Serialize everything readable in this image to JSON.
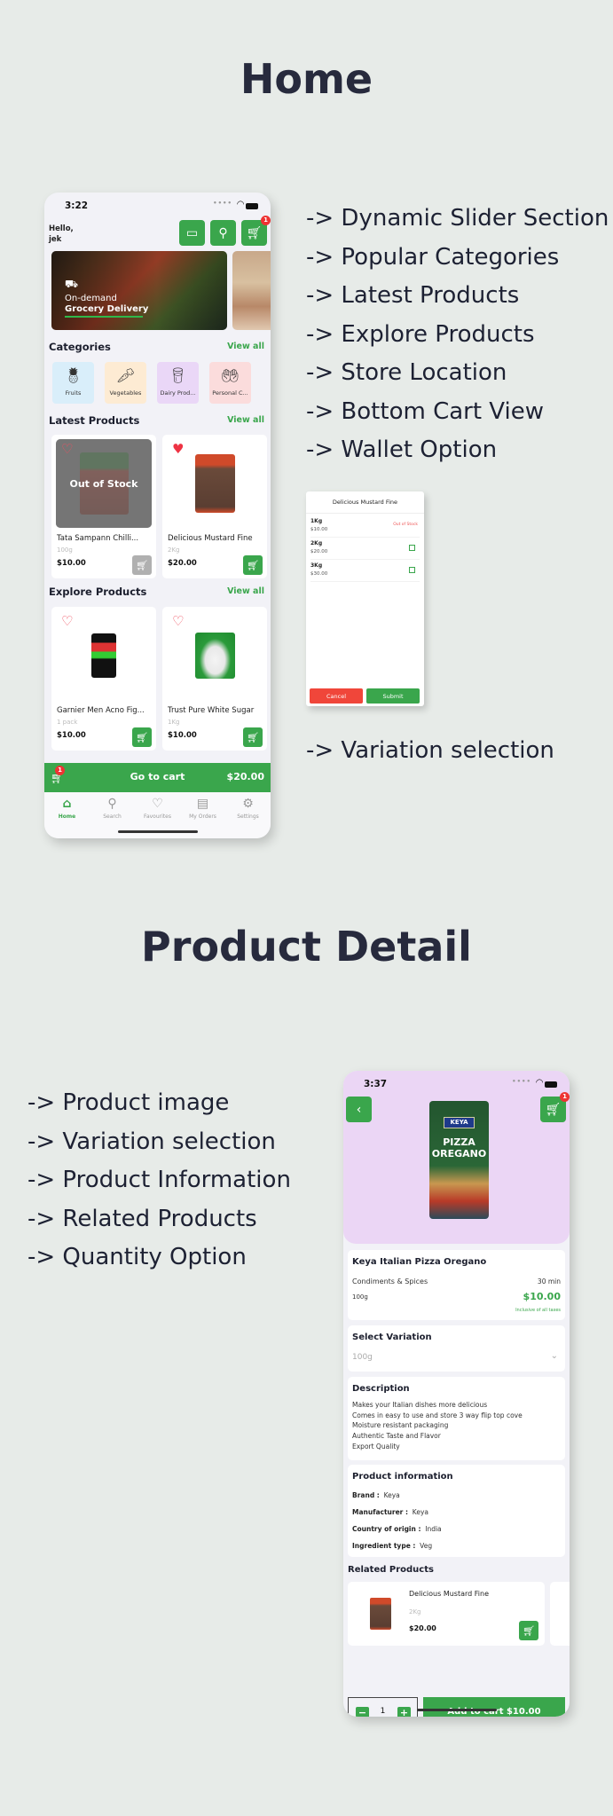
{
  "sections": {
    "home_title": "Home",
    "product_detail_title": "Product Detail"
  },
  "home_features": [
    "-> Dynamic Slider Section",
    "-> Popular Categories",
    "-> Latest Products",
    "-> Explore Products",
    "-> Store Location",
    "-> Bottom Cart View",
    "->  Wallet Option"
  ],
  "variation_feature": "-> Variation selection",
  "detail_features": [
    "-> Product image",
    "-> Variation selection",
    "-> Product Information",
    "-> Related Products",
    "-> Quantity Option"
  ],
  "colors": {
    "brand_green": "#3aa64c",
    "badge_red": "#ee3333",
    "background": "#e7ebe8",
    "heading": "#272a3d"
  },
  "home_screen": {
    "status_time": "3:22",
    "greeting_line1": "Hello,",
    "greeting_line2": "jek",
    "header_buttons": [
      {
        "icon": "wallet-icon"
      },
      {
        "icon": "store-location-icon"
      },
      {
        "icon": "cart-icon",
        "badge": "1"
      }
    ],
    "banner": {
      "line1": "On-demand",
      "line2": "Grocery Delivery"
    },
    "categories_title": "Categories",
    "categories_view_all": "View all",
    "categories": [
      {
        "label": "Fruits",
        "color": "#d9eefa",
        "icon": "fruits-icon"
      },
      {
        "label": "Vegetables",
        "color": "#fdebd3",
        "icon": "vegetables-icon"
      },
      {
        "label": "Dairy Prod...",
        "color": "#ead7f7",
        "icon": "dairy-icon"
      },
      {
        "label": "Personal C...",
        "color": "#fbdcdc",
        "icon": "personal-care-icon"
      }
    ],
    "latest_title": "Latest Products",
    "latest_view_all": "View all",
    "latest_products": [
      {
        "name": "Tata Sampann Chilli...",
        "weight": "100g",
        "price": "$10.00",
        "out_of_stock": true,
        "out_of_stock_label": "Out of Stock",
        "favourite": false
      },
      {
        "name": "Delicious Mustard Fine",
        "weight": "2Kg",
        "price": "$20.00",
        "out_of_stock": false,
        "favourite": true
      }
    ],
    "explore_title": "Explore Products",
    "explore_view_all": "View all",
    "explore_products": [
      {
        "name": "Garnier Men Acno Fig...",
        "weight": "1 pack",
        "price": "$10.00",
        "favourite": false
      },
      {
        "name": "Trust Pure White Sugar",
        "weight": "1Kg",
        "price": "$10.00",
        "favourite": false
      }
    ],
    "cart_bar": {
      "badge": "1",
      "label": "Go to cart",
      "total": "$20.00"
    },
    "tabs": [
      {
        "label": "Home",
        "icon": "home-icon",
        "active": true
      },
      {
        "label": "Search",
        "icon": "search-icon",
        "active": false
      },
      {
        "label": "Favourites",
        "icon": "heart-icon",
        "active": false
      },
      {
        "label": "My Orders",
        "icon": "orders-icon",
        "active": false
      },
      {
        "label": "Settings",
        "icon": "settings-icon",
        "active": false
      }
    ]
  },
  "variation_modal": {
    "title": "Delicious Mustard Fine",
    "options": [
      {
        "weight": "1Kg",
        "price": "$10.00",
        "status": "Out of Stock"
      },
      {
        "weight": "2Kg",
        "price": "$20.00",
        "checked": false
      },
      {
        "weight": "3Kg",
        "price": "$30.00",
        "checked": false
      }
    ],
    "cancel_label": "Cancel",
    "submit_label": "Submit"
  },
  "detail_screen": {
    "status_time": "3:37",
    "cart_badge": "1",
    "product_image_text": {
      "brand": "KEYA",
      "line1": "PIZZA",
      "line2": "OREGANO"
    },
    "name": "Keya Italian Pizza Oregano",
    "category": "Condiments & Spices",
    "delivery_time": "30 min",
    "weight": "100g",
    "price": "$10.00",
    "tax_note": "Inclusive of all taxes",
    "variation_title": "Select Variation",
    "variation_selected": "100g",
    "description_title": "Description",
    "description_lines": [
      "Makes your Italian dishes more delicious",
      "Comes in easy to use and store 3 way flip top cove",
      "Moisture resistant packaging",
      "Authentic Taste and Flavor",
      "Export Quality"
    ],
    "info_title": "Product information",
    "info": [
      {
        "label": "Brand :",
        "value": "Keya"
      },
      {
        "label": "Manufacturer :",
        "value": "Keya"
      },
      {
        "label": "Country of origin :",
        "value": "India"
      },
      {
        "label": "Ingredient type :",
        "value": "Veg"
      }
    ],
    "related_title": "Related Products",
    "related_products": [
      {
        "name": "Delicious Mustard Fine",
        "weight": "2Kg",
        "price": "$20.00"
      }
    ],
    "quantity": "1",
    "add_to_cart_label": "Add to cart $10.00"
  }
}
